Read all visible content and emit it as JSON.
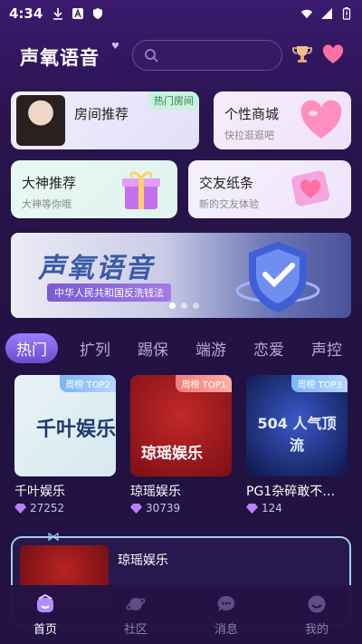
{
  "status": {
    "time": "4:34"
  },
  "header": {
    "logo": "声氧语音",
    "search_placeholder": ""
  },
  "entry_cards": [
    {
      "title": "房间推荐",
      "subtitle": "",
      "badge": "热门房间"
    },
    {
      "title": "个性商城",
      "subtitle": "快拉逛逛吧"
    },
    {
      "title": "大神推荐",
      "subtitle": "大神等你哦"
    },
    {
      "title": "交友纸条",
      "subtitle": "新的交友体验"
    }
  ],
  "banner": {
    "title": "声氧语音",
    "subtitle": "中华人民共和国反洗钱法",
    "page_count": 3,
    "active_page": 0
  },
  "tabs": [
    "热门",
    "扩列",
    "踢保",
    "端游",
    "恋爱",
    "声控"
  ],
  "rooms": [
    {
      "name": "千叶娱乐",
      "rank": "周榜 TOP2",
      "count": "27252",
      "art_text": "千叶娱乐"
    },
    {
      "name": "琼瑶娱乐",
      "rank": "周榜 TOP1",
      "count": "30739",
      "art_text": "琼瑶娱乐"
    },
    {
      "name": "PG1杂碎敢不…",
      "rank": "周榜 TOP3",
      "count": "124",
      "art_text": "504 人气顶流"
    }
  ],
  "live_card": {
    "name": "琼瑶娱乐"
  },
  "bottom_nav": [
    {
      "label": "首页",
      "icon": "home-icon"
    },
    {
      "label": "社区",
      "icon": "planet-icon"
    },
    {
      "label": "消息",
      "icon": "chat-icon"
    },
    {
      "label": "我的",
      "icon": "profile-icon"
    }
  ],
  "colors": {
    "accent": "#7a5ad3",
    "background": "#241344"
  }
}
